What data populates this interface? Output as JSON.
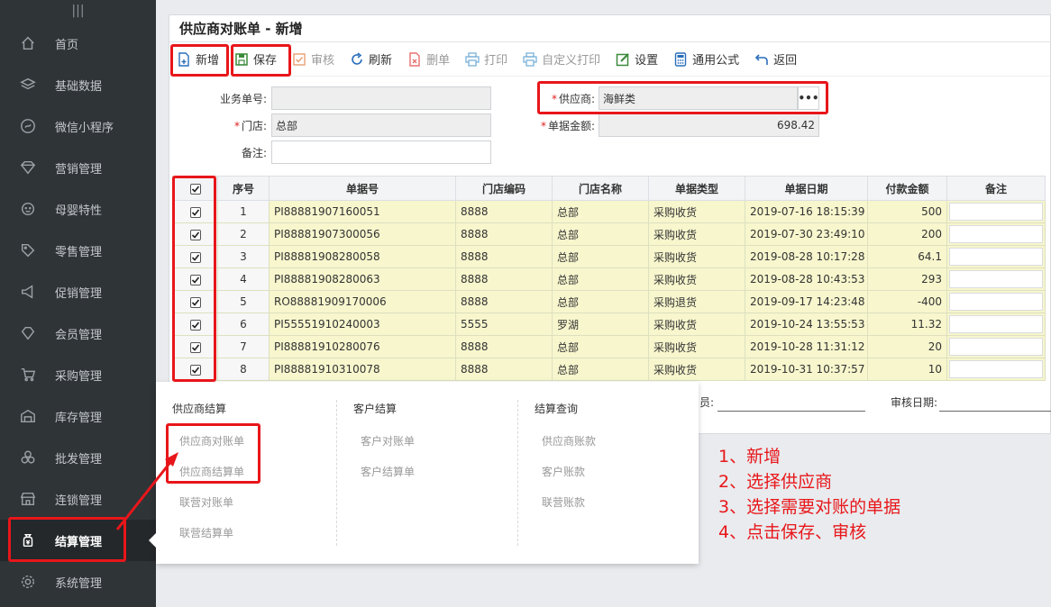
{
  "sidebar": {
    "items": [
      {
        "label": "首页",
        "icon": "home-icon"
      },
      {
        "label": "基础数据",
        "icon": "layers-icon"
      },
      {
        "label": "微信小程序",
        "icon": "miniprogram-icon"
      },
      {
        "label": "营销管理",
        "icon": "diamond-icon"
      },
      {
        "label": "母婴特性",
        "icon": "baby-icon"
      },
      {
        "label": "零售管理",
        "icon": "tag-icon"
      },
      {
        "label": "促销管理",
        "icon": "megaphone-icon"
      },
      {
        "label": "会员管理",
        "icon": "gem-icon"
      },
      {
        "label": "采购管理",
        "icon": "cart-icon"
      },
      {
        "label": "库存管理",
        "icon": "warehouse-icon"
      },
      {
        "label": "批发管理",
        "icon": "boxes-icon"
      },
      {
        "label": "连锁管理",
        "icon": "store-icon"
      },
      {
        "label": "结算管理",
        "icon": "money-bag-icon"
      },
      {
        "label": "系统管理",
        "icon": "gear-icon"
      }
    ]
  },
  "page": {
    "title": "供应商对账单 - 新增"
  },
  "toolbar": {
    "new": "新增",
    "save": "保存",
    "approve": "审核",
    "refresh": "刷新",
    "delete": "删单",
    "print": "打印",
    "custom_print": "自定义打印",
    "settings": "设置",
    "formula": "通用公式",
    "back": "返回"
  },
  "form": {
    "order_no_label": "业务单号:",
    "order_no_value": "",
    "store_label": "门店:",
    "store_value": "总部",
    "remark_label": "备注:",
    "remark_value": "",
    "supplier_label": "供应商:",
    "supplier_value": "海鲜类",
    "amount_label": "单据金额:",
    "amount_value": "698.42",
    "dots": "•••"
  },
  "table": {
    "headers": [
      "序号",
      "单据号",
      "门店编码",
      "门店名称",
      "单据类型",
      "单据日期",
      "付款金额",
      "备注"
    ],
    "rows": [
      {
        "idx": "1",
        "no": "PI88881907160051",
        "code": "8888",
        "store": "总部",
        "type": "采购收货",
        "date": "2019-07-16 18:15:39",
        "amount": "500"
      },
      {
        "idx": "2",
        "no": "PI88881907300056",
        "code": "8888",
        "store": "总部",
        "type": "采购收货",
        "date": "2019-07-30 23:49:10",
        "amount": "200"
      },
      {
        "idx": "3",
        "no": "PI88881908280058",
        "code": "8888",
        "store": "总部",
        "type": "采购收货",
        "date": "2019-08-28 10:17:28",
        "amount": "64.1"
      },
      {
        "idx": "4",
        "no": "PI88881908280063",
        "code": "8888",
        "store": "总部",
        "type": "采购收货",
        "date": "2019-08-28 10:43:53",
        "amount": "293"
      },
      {
        "idx": "5",
        "no": "RO88881909170006",
        "code": "8888",
        "store": "总部",
        "type": "采购退货",
        "date": "2019-09-17 14:23:48",
        "amount": "-400"
      },
      {
        "idx": "6",
        "no": "PI55551910240003",
        "code": "5555",
        "store": "罗湖",
        "type": "采购收货",
        "date": "2019-10-24 13:55:53",
        "amount": "11.32"
      },
      {
        "idx": "7",
        "no": "PI88881910280076",
        "code": "8888",
        "store": "总部",
        "type": "采购收货",
        "date": "2019-10-28 11:31:12",
        "amount": "20"
      },
      {
        "idx": "8",
        "no": "PI88881910310078",
        "code": "8888",
        "store": "总部",
        "type": "采购收货",
        "date": "2019-10-31 10:37:57",
        "amount": "10"
      }
    ]
  },
  "footer": {
    "operator_label": "员:",
    "audit_date_label": "审核日期:"
  },
  "menu": {
    "col1": {
      "title": "供应商结算",
      "items": [
        "供应商对账单",
        "供应商结算单",
        "联营对账单",
        "联营结算单"
      ]
    },
    "col2": {
      "title": "客户结算",
      "items": [
        "客户对账单",
        "客户结算单"
      ]
    },
    "col3": {
      "title": "结算查询",
      "items": [
        "供应商账款",
        "客户账款",
        "联营账款"
      ]
    }
  },
  "annotations": [
    "1、新增",
    "2、选择供应商",
    "3、选择需要对账的单据",
    "4、点击保存、审核"
  ],
  "colors": {
    "sidebar_bg": "#2f3437",
    "highlight_red": "#e8161a",
    "row_yellow": "#f7f6cd"
  }
}
